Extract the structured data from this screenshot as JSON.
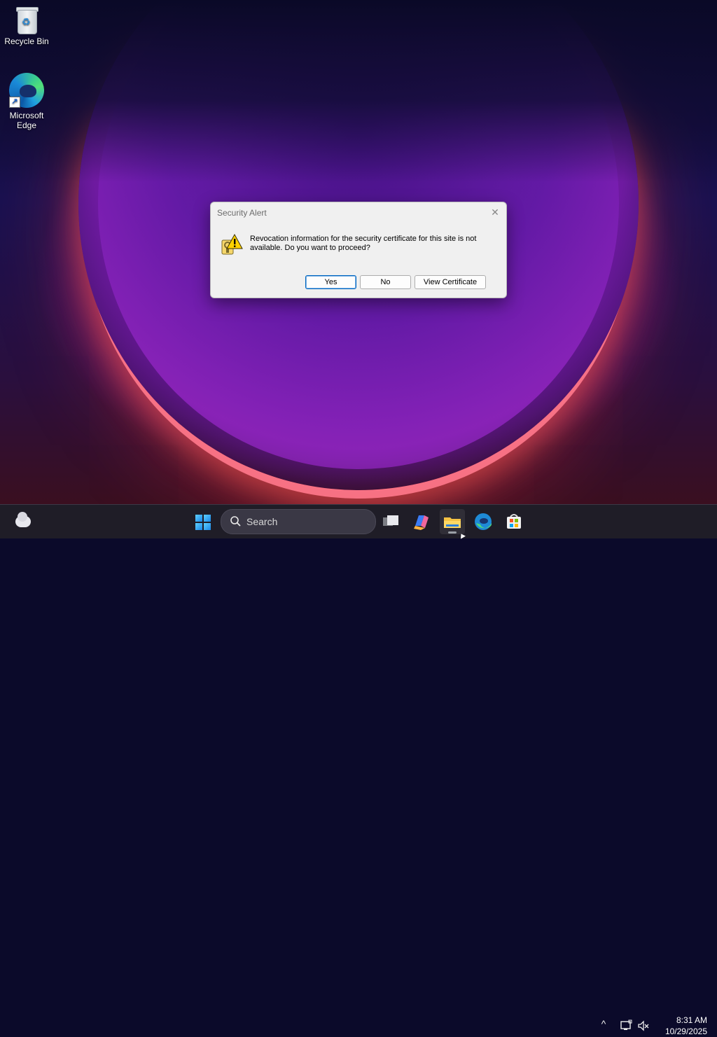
{
  "desktop": {
    "icons": [
      {
        "label": "Recycle Bin"
      },
      {
        "label": "Microsoft Edge"
      }
    ]
  },
  "dialog": {
    "title": "Security Alert",
    "close_glyph": "✕",
    "message": "Revocation information for the security certificate for this site is not available. Do you want to proceed?",
    "buttons": {
      "yes": "Yes",
      "no": "No",
      "view_certificate": "View Certificate"
    }
  },
  "taskbar": {
    "search_label": "Search",
    "pinned": [
      "task-view-icon",
      "copilot-icon",
      "file-explorer-icon",
      "edge-icon",
      "microsoft-store-icon"
    ],
    "tray": {
      "chevron": "^",
      "time": "8:31 AM",
      "date": "10/29/2025"
    }
  },
  "colors": {
    "accent": "#0067c0",
    "taskbar": "#201e28"
  }
}
